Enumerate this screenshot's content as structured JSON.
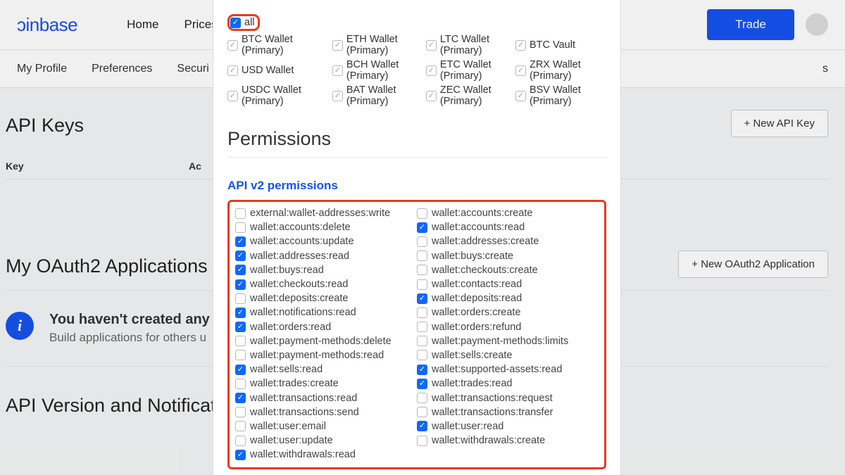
{
  "brand": "ɔinbase",
  "nav": {
    "home": "Home",
    "prices": "Prices"
  },
  "trade_btn": "Trade",
  "subnav": {
    "profile": "My Profile",
    "prefs": "Preferences",
    "security": "Securi",
    "activity_trunc": "s"
  },
  "api_keys": {
    "title": "API Keys",
    "new_btn": "+  New API Key",
    "col_key": "Key",
    "col_actions": "Ac"
  },
  "oauth": {
    "title": "My OAuth2 Applications",
    "new_btn": "+  New OAuth2 Application",
    "info_title": "You haven't created any OA",
    "info_sub": "Build applications for others u"
  },
  "versions": {
    "title": "API Version and Notifications",
    "footer_trunc": ""
  },
  "modal": {
    "all_label": "all",
    "wallets": [
      [
        "BTC Wallet (Primary)",
        "ETH Wallet (Primary)",
        "LTC Wallet (Primary)",
        "BTC Vault"
      ],
      [
        "USD Wallet",
        "BCH Wallet (Primary)",
        "ETC Wallet (Primary)",
        "ZRX Wallet (Primary)"
      ],
      [
        "USDC Wallet (Primary)",
        "BAT Wallet (Primary)",
        "ZEC Wallet (Primary)",
        "BSV Wallet (Primary)"
      ]
    ],
    "perm_title": "Permissions",
    "perm_sub": "API v2 permissions",
    "perms_left": [
      {
        "l": "external:wallet-addresses:write",
        "c": false
      },
      {
        "l": "wallet:accounts:delete",
        "c": false
      },
      {
        "l": "wallet:accounts:update",
        "c": true
      },
      {
        "l": "wallet:addresses:read",
        "c": true
      },
      {
        "l": "wallet:buys:read",
        "c": true
      },
      {
        "l": "wallet:checkouts:read",
        "c": true
      },
      {
        "l": "wallet:deposits:create",
        "c": false
      },
      {
        "l": "wallet:notifications:read",
        "c": true
      },
      {
        "l": "wallet:orders:read",
        "c": true
      },
      {
        "l": "wallet:payment-methods:delete",
        "c": false
      },
      {
        "l": "wallet:payment-methods:read",
        "c": false
      },
      {
        "l": "wallet:sells:read",
        "c": true
      },
      {
        "l": "wallet:trades:create",
        "c": false
      },
      {
        "l": "wallet:transactions:read",
        "c": true
      },
      {
        "l": "wallet:transactions:send",
        "c": false
      },
      {
        "l": "wallet:user:email",
        "c": false
      },
      {
        "l": "wallet:user:update",
        "c": false
      },
      {
        "l": "wallet:withdrawals:read",
        "c": true
      }
    ],
    "perms_right": [
      {
        "l": "wallet:accounts:create",
        "c": false
      },
      {
        "l": "wallet:accounts:read",
        "c": true
      },
      {
        "l": "wallet:addresses:create",
        "c": false
      },
      {
        "l": "wallet:buys:create",
        "c": false
      },
      {
        "l": "wallet:checkouts:create",
        "c": false
      },
      {
        "l": "wallet:contacts:read",
        "c": false
      },
      {
        "l": "wallet:deposits:read",
        "c": true
      },
      {
        "l": "wallet:orders:create",
        "c": false
      },
      {
        "l": "wallet:orders:refund",
        "c": false
      },
      {
        "l": "wallet:payment-methods:limits",
        "c": false
      },
      {
        "l": "wallet:sells:create",
        "c": false
      },
      {
        "l": "wallet:supported-assets:read",
        "c": true
      },
      {
        "l": "wallet:trades:read",
        "c": true
      },
      {
        "l": "wallet:transactions:request",
        "c": false
      },
      {
        "l": "wallet:transactions:transfer",
        "c": false
      },
      {
        "l": "wallet:user:read",
        "c": true
      },
      {
        "l": "wallet:withdrawals:create",
        "c": false
      }
    ]
  }
}
